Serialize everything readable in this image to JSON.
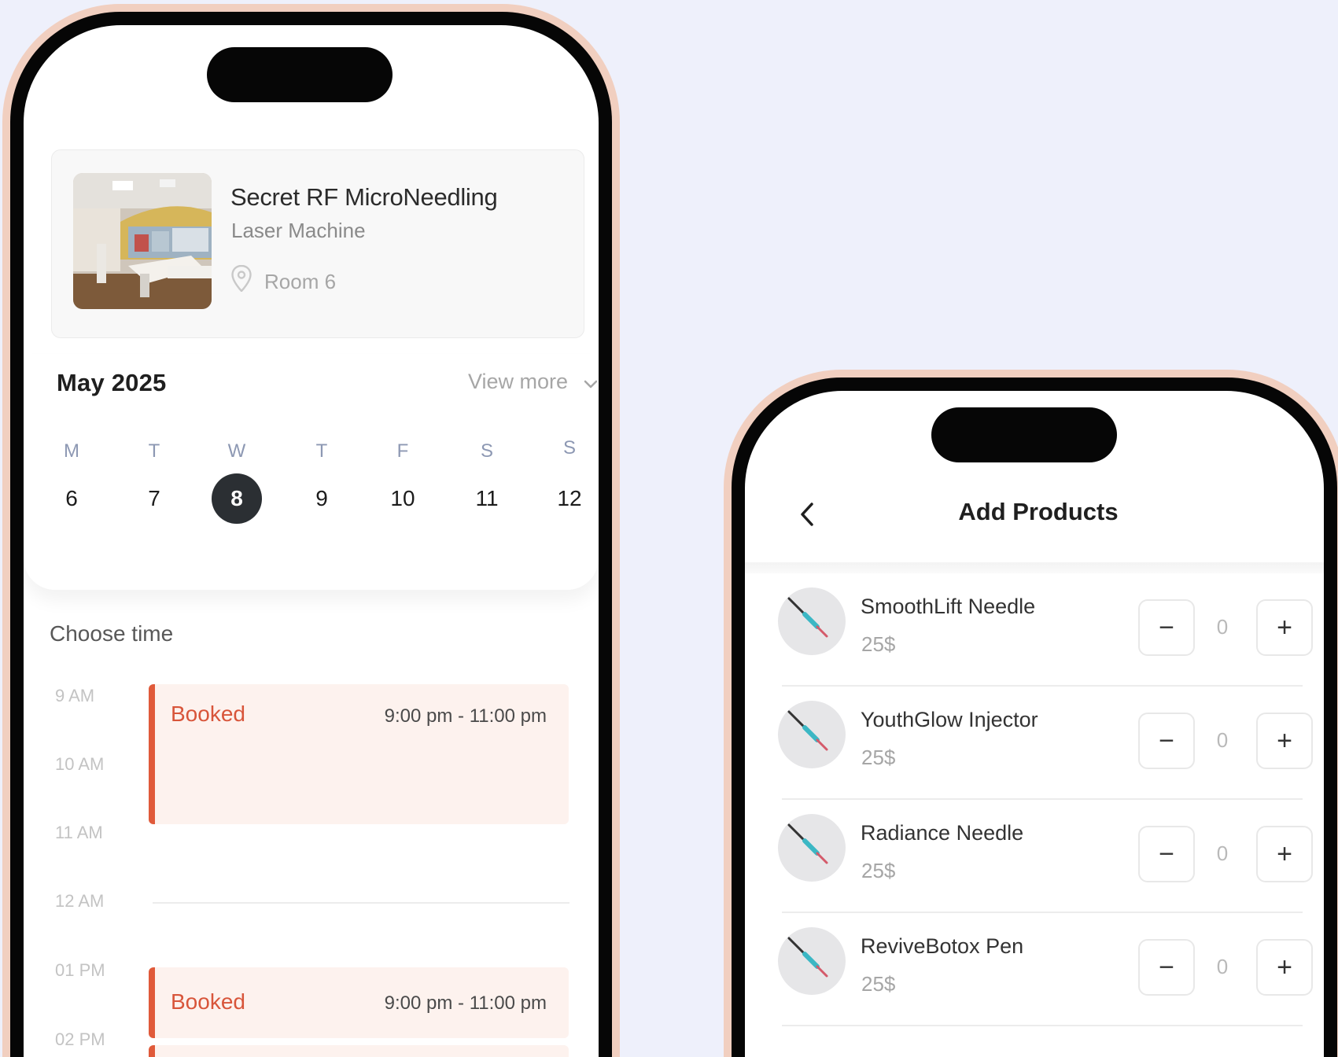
{
  "booking": {
    "service": {
      "title": "Secret RF MicroNeedling",
      "subtitle": "Laser Machine",
      "location": "Room 6",
      "location_icon": "map-pin-icon"
    },
    "calendar": {
      "month": "May 2025",
      "view_more": "View more",
      "weekdays": [
        "M",
        "T",
        "W",
        "T",
        "F",
        "S",
        "S"
      ],
      "days": [
        "6",
        "7",
        "8",
        "9",
        "10",
        "11",
        "12"
      ],
      "selected_day": "8"
    },
    "schedule": {
      "heading": "Choose time",
      "times": [
        "9 AM",
        "10 AM",
        "11 AM",
        "12 AM",
        "01 PM",
        "02 PM"
      ],
      "slots": [
        {
          "status": "Booked",
          "range": "9:00 pm - 11:00 pm"
        },
        {
          "status": "Booked",
          "range": "9:00 pm - 11:00 pm"
        }
      ]
    }
  },
  "products_screen": {
    "title": "Add Products",
    "back_icon": "chevron-left-icon",
    "minus": "−",
    "plus": "+",
    "items": [
      {
        "name": "SmoothLift Needle",
        "price": "25$",
        "qty": "0"
      },
      {
        "name": "YouthGlow Injector",
        "price": "25$",
        "qty": "0"
      },
      {
        "name": "Radiance Needle",
        "price": "25$",
        "qty": "0"
      },
      {
        "name": "ReviveBotox Pen",
        "price": "25$",
        "qty": "0"
      }
    ]
  },
  "colors": {
    "background": "#eef0fb",
    "frame_accent": "#f1cfc0",
    "booked_accent": "#e05a3a",
    "booked_bg": "#fdf2ee",
    "selected_day_bg": "#2b2f33"
  }
}
